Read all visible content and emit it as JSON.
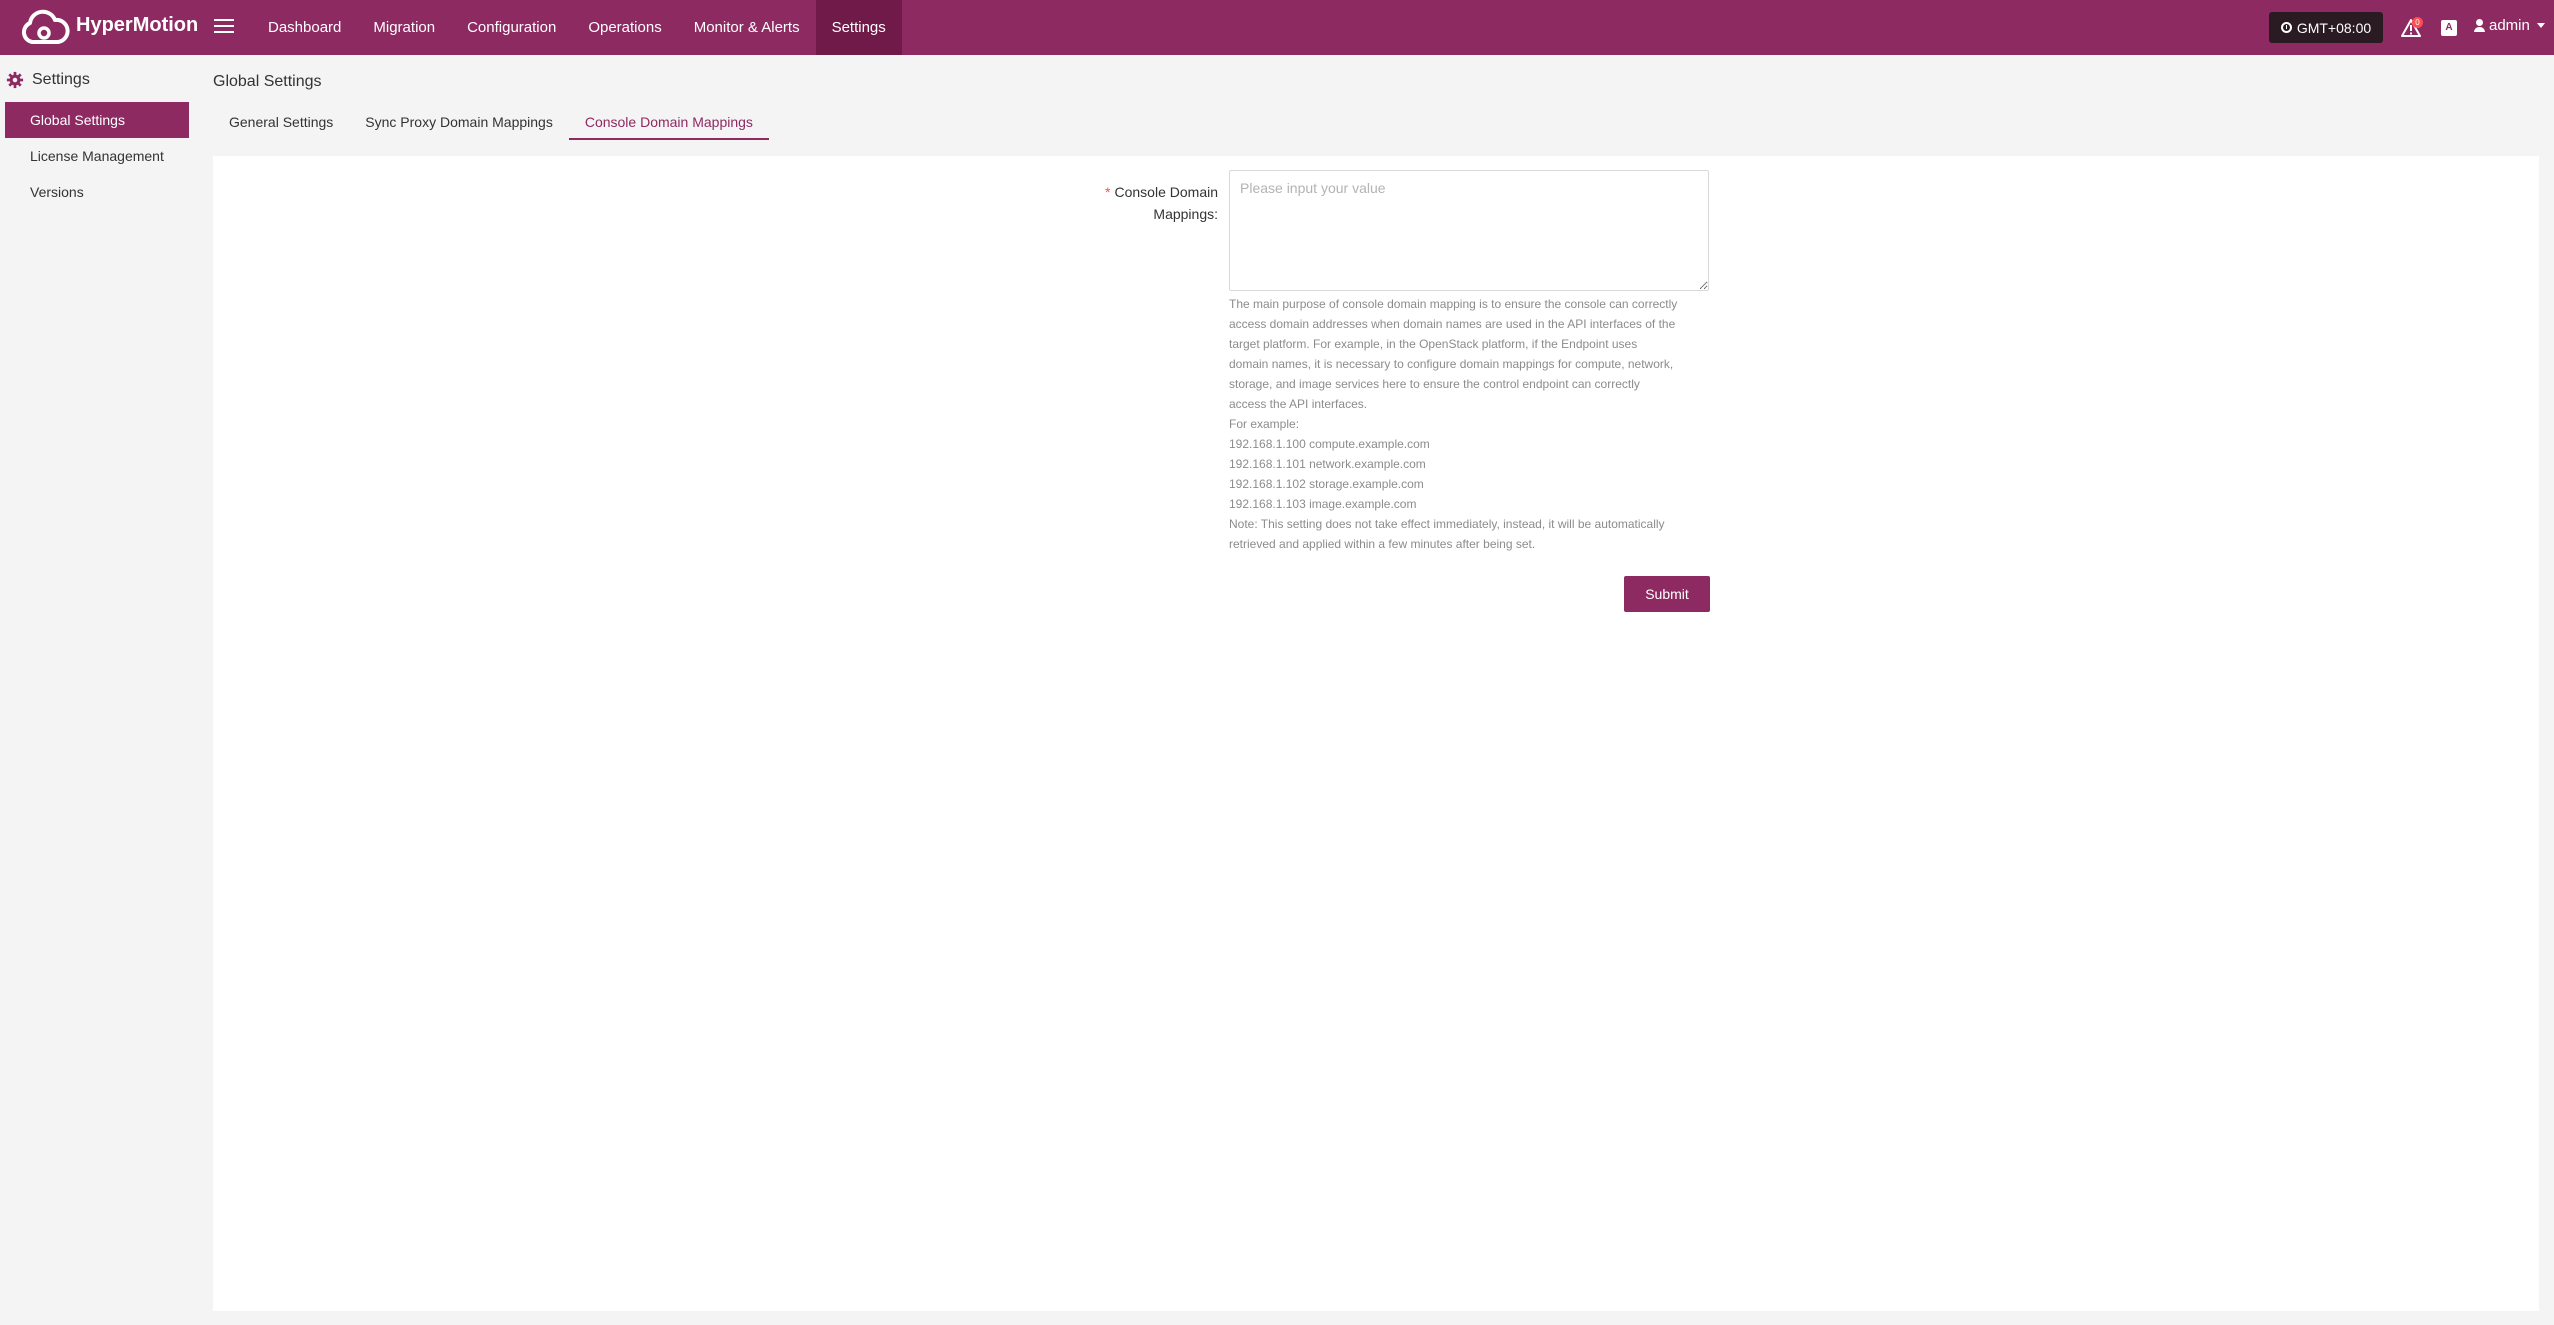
{
  "app": {
    "brand": "HyperMotion"
  },
  "nav": [
    {
      "label": "Dashboard"
    },
    {
      "label": "Migration"
    },
    {
      "label": "Configuration"
    },
    {
      "label": "Operations"
    },
    {
      "label": "Monitor & Alerts"
    },
    {
      "label": "Settings",
      "active": true
    }
  ],
  "header": {
    "timezone": "GMT+08:00",
    "alert_count": "0",
    "user": "admin"
  },
  "sidebar": {
    "title": "Settings",
    "items": [
      {
        "label": "Global Settings",
        "active": true
      },
      {
        "label": "License Management"
      },
      {
        "label": "Versions"
      }
    ]
  },
  "main": {
    "title": "Global Settings",
    "tabs": [
      {
        "label": "General Settings"
      },
      {
        "label": "Sync Proxy Domain Mappings"
      },
      {
        "label": "Console Domain Mappings",
        "active": true
      }
    ],
    "form": {
      "label_line1": "Console Domain",
      "label_line2": "Mappings:",
      "value": "",
      "placeholder": "Please input your value",
      "help_line1": "The main purpose of console domain mapping is to ensure the console can correctly",
      "help_line2": "access domain addresses when domain names are used in the API interfaces of the",
      "help_line3": "target platform. For example, in the OpenStack platform, if the Endpoint uses",
      "help_line4": "domain names, it is necessary to configure domain mappings for compute, network,",
      "help_line5": "storage, and image services here to ensure the control endpoint can correctly",
      "help_line6": "access the API interfaces.",
      "example_title": "For example:",
      "examples": [
        "192.168.1.100 compute.example.com",
        "192.168.1.101 network.example.com",
        "192.168.1.102 storage.example.com",
        "192.168.1.103 image.example.com"
      ],
      "note_line1": "Note: This setting does not take effect immediately, instead, it will be automatically",
      "note_line2": "retrieved and applied within a few minutes after being set.",
      "submit_label": "Submit"
    }
  },
  "colors": {
    "brand": "#8e2a62",
    "brand_dark": "#6f1a49",
    "required": "#ff4d4f"
  },
  "icons": [
    "cloud-logo-icon",
    "hamburger-icon",
    "clock-icon",
    "alert-icon",
    "translate-icon",
    "user-icon",
    "chevron-down-icon",
    "gear-icon"
  ]
}
